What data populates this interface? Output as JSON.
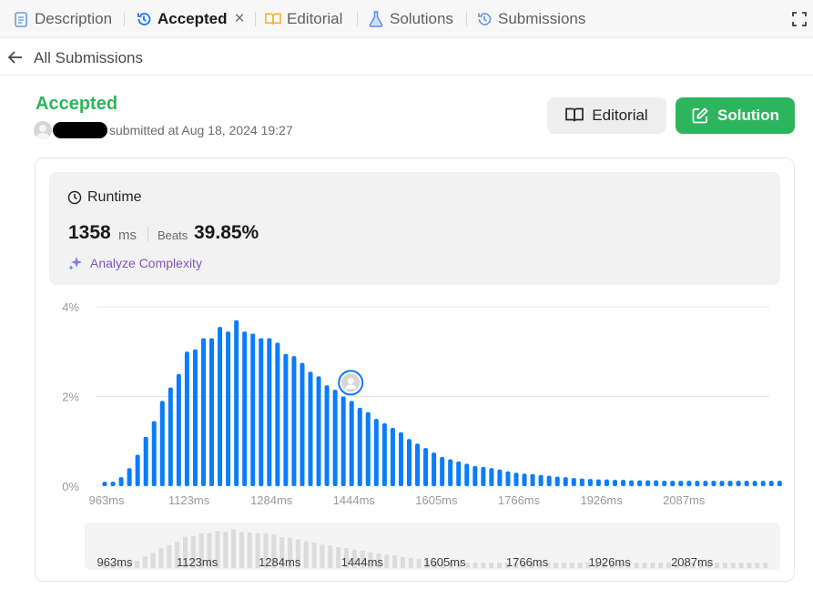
{
  "tabs": [
    {
      "label": "Description",
      "icon": "description-icon",
      "active": false
    },
    {
      "label": "Accepted",
      "icon": "history-icon",
      "active": true
    },
    {
      "label": "Editorial",
      "icon": "book-icon",
      "active": false
    },
    {
      "label": "Solutions",
      "icon": "flask-icon",
      "active": false
    },
    {
      "label": "Submissions",
      "icon": "history-icon",
      "active": false
    }
  ],
  "back": {
    "label": "All Submissions"
  },
  "submission": {
    "status": "Accepted",
    "submitted_text": "submitted at Aug 18, 2024 19:27"
  },
  "buttons": {
    "editorial": "Editorial",
    "solution": "Solution"
  },
  "runtime": {
    "title": "Runtime",
    "value": "1358",
    "unit": "ms",
    "beats_label": "Beats",
    "beats_value": "39.85%",
    "analyze_label": "Analyze Complexity"
  },
  "colors": {
    "accepted_green": "#2db55d",
    "bar_blue": "#0a7cff",
    "analyze_purple": "#7e57c2"
  },
  "chart_data": {
    "type": "bar",
    "xlabel": "",
    "ylabel": "",
    "y_ticks": [
      "0%",
      "2%",
      "4%"
    ],
    "ylim": [
      0,
      4
    ],
    "x_ticks": [
      "963ms",
      "1123ms",
      "1284ms",
      "1444ms",
      "1605ms",
      "1766ms",
      "1926ms",
      "2087ms"
    ],
    "user_bar_index": 30,
    "grid": true,
    "values": [
      0.1,
      0.1,
      0.2,
      0.4,
      0.7,
      1.1,
      1.45,
      1.9,
      2.2,
      2.5,
      3.0,
      3.05,
      3.3,
      3.3,
      3.55,
      3.45,
      3.7,
      3.45,
      3.4,
      3.3,
      3.3,
      3.2,
      2.95,
      2.9,
      2.75,
      2.55,
      2.45,
      2.25,
      2.15,
      2.0,
      1.9,
      1.75,
      1.65,
      1.5,
      1.4,
      1.3,
      1.2,
      1.05,
      0.95,
      0.85,
      0.75,
      0.65,
      0.6,
      0.55,
      0.5,
      0.45,
      0.43,
      0.4,
      0.37,
      0.33,
      0.3,
      0.28,
      0.27,
      0.25,
      0.23,
      0.21,
      0.2,
      0.18,
      0.17,
      0.16,
      0.15,
      0.15,
      0.14,
      0.14,
      0.13,
      0.13,
      0.13,
      0.13,
      0.12,
      0.12,
      0.12,
      0.12,
      0.12,
      0.12,
      0.12,
      0.12,
      0.12,
      0.12,
      0.12,
      0.12,
      0.12,
      0.12,
      0.12
    ]
  }
}
